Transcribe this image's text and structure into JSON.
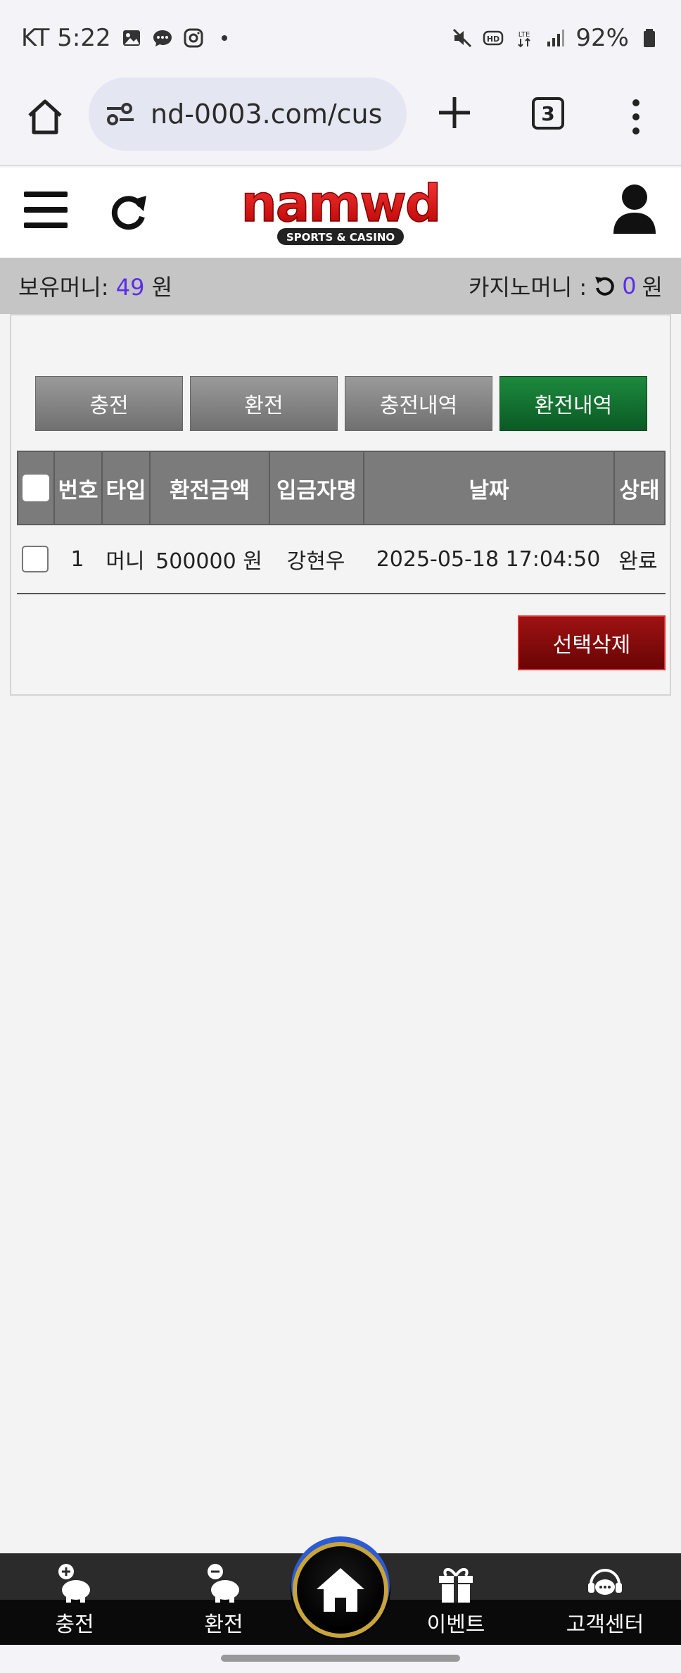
{
  "status_bar": {
    "carrier_time": "KT 5:22",
    "battery": "92%",
    "icons_left": [
      "gallery-icon",
      "message-icon",
      "instagram-icon",
      "dot-icon"
    ],
    "icons_right": [
      "mute-icon",
      "hd-icon",
      "lte-icon",
      "signal-icon",
      "battery-icon"
    ]
  },
  "browser": {
    "url": "nd-0003.com/cus",
    "tab_count": "3"
  },
  "site": {
    "logo_text": "namwd",
    "logo_subtext": "SPORTS & CASINO"
  },
  "money_bar": {
    "holding_label": "보유머니:",
    "holding_value": "49",
    "holding_unit": "원",
    "casino_label": "카지노머니 :",
    "casino_value": "0",
    "casino_unit": "원",
    "accent_color": "#5a2ee8"
  },
  "tabs": [
    {
      "label": "충전",
      "active": false
    },
    {
      "label": "환전",
      "active": false
    },
    {
      "label": "충전내역",
      "active": false
    },
    {
      "label": "환전내역",
      "active": true
    }
  ],
  "table": {
    "headers": [
      "번호",
      "타입",
      "환전금액",
      "입금자명",
      "날짜",
      "상태"
    ],
    "rows": [
      {
        "no": "1",
        "type": "머니",
        "amount": "500000 원",
        "name": "강현우",
        "date": "2025-05-18 17:04:50",
        "status": "완료"
      }
    ]
  },
  "delete_button": "선택삭제",
  "bottom_nav": {
    "charge": "충전",
    "exchange": "환전",
    "event": "이벤트",
    "support": "고객센터"
  }
}
